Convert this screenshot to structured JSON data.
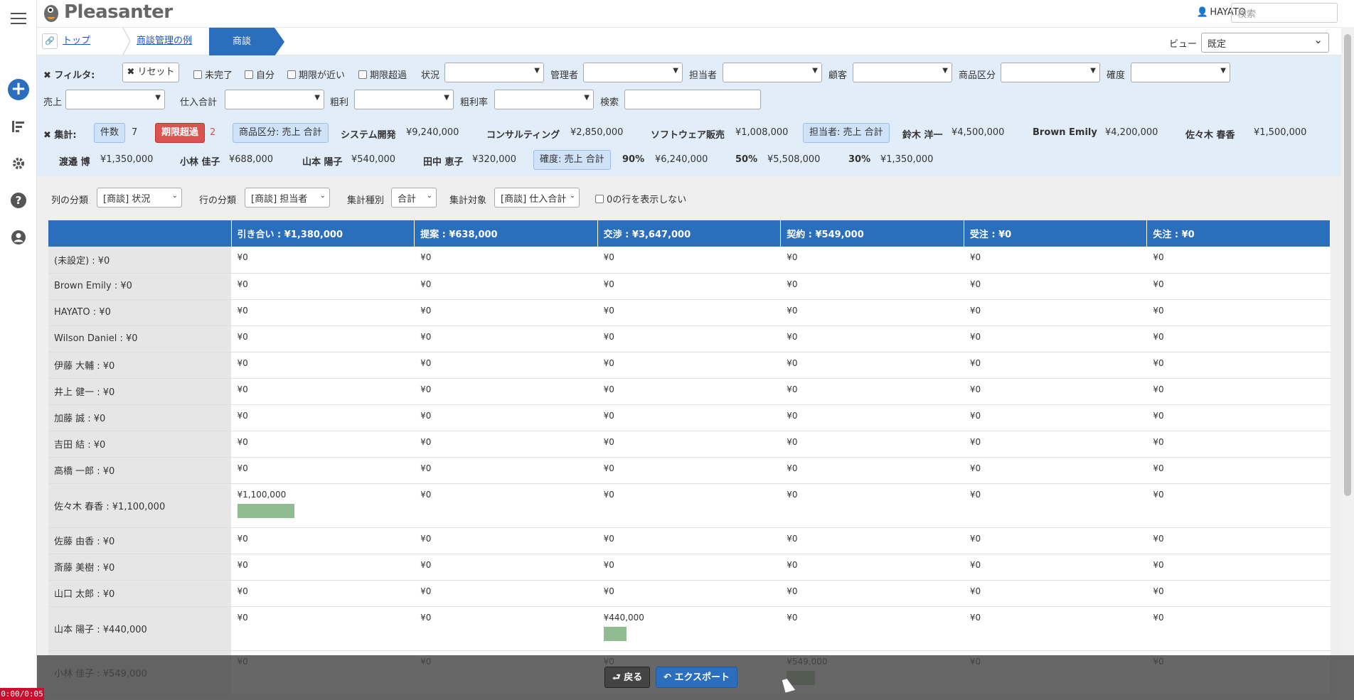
{
  "app": {
    "name": "Pleasanter"
  },
  "header": {
    "user_name": "HAYATO",
    "search_placeholder": "検索"
  },
  "breadcrumb": {
    "top": "トップ",
    "parent": "商談管理の例",
    "current": "商談"
  },
  "view": {
    "label": "ビュー",
    "selected": "既定"
  },
  "filter": {
    "label": "フィルタ:",
    "reset": "リセット",
    "checks": [
      "未完了",
      "自分",
      "期限が近い",
      "期限超過"
    ],
    "fields_row1": [
      "状況",
      "管理者",
      "担当者",
      "顧客",
      "商品区分",
      "確度"
    ],
    "fields_row2": [
      "売上",
      "仕入合計",
      "粗利",
      "粗利率",
      "検索"
    ]
  },
  "aggregate": {
    "label": "集計:",
    "count_label": "件数",
    "count_value": "7",
    "overdue_label": "期限超過",
    "overdue_value": "2",
    "group1_label": "商品区分: 売上 合計",
    "group1": [
      {
        "name": "システム開発",
        "value": "¥9,240,000"
      },
      {
        "name": "コンサルティング",
        "value": "¥2,850,000"
      },
      {
        "name": "ソフトウェア販売",
        "value": "¥1,008,000"
      }
    ],
    "group2_label": "担当者: 売上 合計",
    "group2_first": [
      {
        "name": "鈴木 洋一",
        "value": "¥4,500,000"
      },
      {
        "name": "Brown Emily",
        "value": "¥4,200,000"
      },
      {
        "name": "佐々木 春香",
        "value": "¥1,500,000"
      }
    ],
    "group2_second": [
      {
        "name": "渡邉 博",
        "value": "¥1,350,000"
      },
      {
        "name": "小林 佳子",
        "value": "¥688,000"
      },
      {
        "name": "山本 陽子",
        "value": "¥540,000"
      },
      {
        "name": "田中 恵子",
        "value": "¥320,000"
      }
    ],
    "group3_label": "確度: 売上 合計",
    "group3": [
      {
        "name": "90%",
        "value": "¥6,240,000"
      },
      {
        "name": "50%",
        "value": "¥5,508,000"
      },
      {
        "name": "30%",
        "value": "¥1,350,000"
      }
    ]
  },
  "crosstab": {
    "col_group_label": "列の分類",
    "col_group_value": "[商談] 状況",
    "row_group_label": "行の分類",
    "row_group_value": "[商談] 担当者",
    "agg_type_label": "集計種別",
    "agg_type_value": "合計",
    "agg_target_label": "集計対象",
    "agg_target_value": "[商談] 仕入合計",
    "hide_zero_label": "0の行を表示しない",
    "columns": [
      "引き合い : ¥1,380,000",
      "提案 : ¥638,000",
      "交渉 : ¥3,647,000",
      "契約 : ¥549,000",
      "受注 : ¥0",
      "失注 : ¥0"
    ],
    "rows": [
      {
        "label": "(未設定) : ¥0",
        "cells": [
          "¥0",
          "¥0",
          "¥0",
          "¥0",
          "¥0",
          "¥0"
        ],
        "bars": [
          0,
          0,
          0,
          0,
          0,
          0
        ]
      },
      {
        "label": "Brown Emily : ¥0",
        "cells": [
          "¥0",
          "¥0",
          "¥0",
          "¥0",
          "¥0",
          "¥0"
        ],
        "bars": [
          0,
          0,
          0,
          0,
          0,
          0
        ]
      },
      {
        "label": "HAYATO : ¥0",
        "cells": [
          "¥0",
          "¥0",
          "¥0",
          "¥0",
          "¥0",
          "¥0"
        ],
        "bars": [
          0,
          0,
          0,
          0,
          0,
          0
        ]
      },
      {
        "label": "Wilson Daniel : ¥0",
        "cells": [
          "¥0",
          "¥0",
          "¥0",
          "¥0",
          "¥0",
          "¥0"
        ],
        "bars": [
          0,
          0,
          0,
          0,
          0,
          0
        ]
      },
      {
        "label": "伊藤 大輔 : ¥0",
        "cells": [
          "¥0",
          "¥0",
          "¥0",
          "¥0",
          "¥0",
          "¥0"
        ],
        "bars": [
          0,
          0,
          0,
          0,
          0,
          0
        ]
      },
      {
        "label": "井上 健一 : ¥0",
        "cells": [
          "¥0",
          "¥0",
          "¥0",
          "¥0",
          "¥0",
          "¥0"
        ],
        "bars": [
          0,
          0,
          0,
          0,
          0,
          0
        ]
      },
      {
        "label": "加藤 誠 : ¥0",
        "cells": [
          "¥0",
          "¥0",
          "¥0",
          "¥0",
          "¥0",
          "¥0"
        ],
        "bars": [
          0,
          0,
          0,
          0,
          0,
          0
        ]
      },
      {
        "label": "吉田 結 : ¥0",
        "cells": [
          "¥0",
          "¥0",
          "¥0",
          "¥0",
          "¥0",
          "¥0"
        ],
        "bars": [
          0,
          0,
          0,
          0,
          0,
          0
        ]
      },
      {
        "label": "高橋 一郎 : ¥0",
        "cells": [
          "¥0",
          "¥0",
          "¥0",
          "¥0",
          "¥0",
          "¥0"
        ],
        "bars": [
          0,
          0,
          0,
          0,
          0,
          0
        ]
      },
      {
        "label": "佐々木 春香 : ¥1,100,000",
        "cells": [
          "¥1,100,000",
          "¥0",
          "¥0",
          "¥0",
          "¥0",
          "¥0"
        ],
        "bars": [
          0.8,
          0,
          0,
          0,
          0,
          0
        ]
      },
      {
        "label": "佐藤 由香 : ¥0",
        "cells": [
          "¥0",
          "¥0",
          "¥0",
          "¥0",
          "¥0",
          "¥0"
        ],
        "bars": [
          0,
          0,
          0,
          0,
          0,
          0
        ]
      },
      {
        "label": "斎藤 美樹 : ¥0",
        "cells": [
          "¥0",
          "¥0",
          "¥0",
          "¥0",
          "¥0",
          "¥0"
        ],
        "bars": [
          0,
          0,
          0,
          0,
          0,
          0
        ]
      },
      {
        "label": "山口 太郎 : ¥0",
        "cells": [
          "¥0",
          "¥0",
          "¥0",
          "¥0",
          "¥0",
          "¥0"
        ],
        "bars": [
          0,
          0,
          0,
          0,
          0,
          0
        ]
      },
      {
        "label": "山本 陽子 : ¥440,000",
        "cells": [
          "¥0",
          "¥0",
          "¥440,000",
          "¥0",
          "¥0",
          "¥0"
        ],
        "bars": [
          0,
          0,
          0.32,
          0,
          0,
          0
        ]
      },
      {
        "label": "小林 佳子 : ¥549,000",
        "cells": [
          "¥0",
          "¥0",
          "¥0",
          "¥549,000",
          "¥0",
          "¥0"
        ],
        "bars": [
          0,
          0,
          0,
          0.4,
          0,
          0
        ]
      }
    ]
  },
  "bottom": {
    "back": "戻る",
    "export": "エクスポート"
  },
  "recording": {
    "timer": "0:00/0:05"
  },
  "colors": {
    "accent": "#2a6ebd",
    "bar": "#8fbd8f",
    "danger": "#d9534f"
  }
}
